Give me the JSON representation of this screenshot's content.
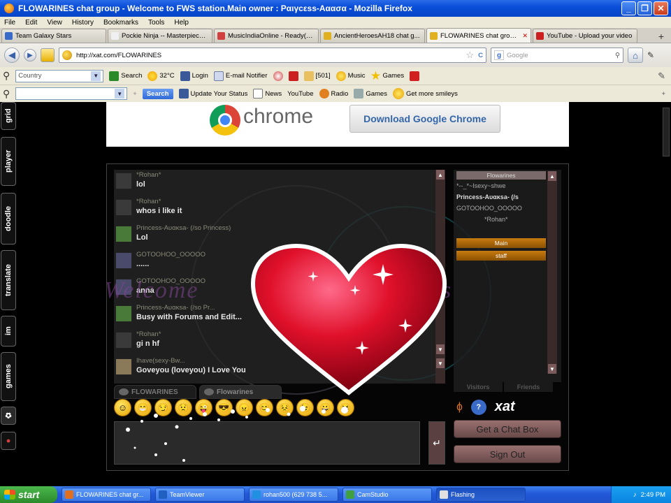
{
  "window": {
    "title": "FLOWARINES chat group - Welcome to FWS station.Main owner : Ραιγcεss-Ααασα - Mozilla Firefox",
    "controls": [
      "_",
      "❐",
      "✕"
    ]
  },
  "menu": [
    "File",
    "Edit",
    "View",
    "History",
    "Bookmarks",
    "Tools",
    "Help"
  ],
  "tabs": [
    {
      "label": "Team Galaxy Stars",
      "color": "#3a6ac8"
    },
    {
      "label": "Pockie Ninja -- Masterpiece ...",
      "color": "#f0f0f0"
    },
    {
      "label": "MusicIndiaOnline - Ready(2...",
      "color": "#d04040"
    },
    {
      "label": "AncientHeroesAH18 chat g...",
      "color": "#e0b020"
    },
    {
      "label": "FLOWARINES chat group - ...",
      "color": "#e0b020",
      "active": true
    },
    {
      "label": "YouTube - Upload your video",
      "color": "#cc2020"
    }
  ],
  "newtab_label": "+",
  "nav": {
    "back": "◀",
    "forward": "▶",
    "url": "http://xat.com/FLOWARINES",
    "search_placeholder": "Google",
    "star": "☆",
    "reload": "C"
  },
  "toolbar1": {
    "country_placeholder": "Country",
    "search_label": "Search",
    "temperature": "32°C",
    "login": "Login",
    "email_notifier": "E-mail Notifier",
    "count": "[501]",
    "music": "Music",
    "games": "Games"
  },
  "toolbar2": {
    "search_button": "Search",
    "update_status": "Update Your Status",
    "news": "News",
    "youtube": "YouTube",
    "radio": "Radio",
    "games": "Games",
    "smileys": "Get more smileys"
  },
  "sidebar": [
    "grid",
    "player",
    "doodle",
    "translate",
    "im",
    "games",
    ""
  ],
  "ad": {
    "brand": "chrome",
    "button": "Download Google Chrome"
  },
  "chat": {
    "welcome_text": "Welcome",
    "welcome_tail": "ines",
    "messages": [
      {
        "name": "*Rohan*",
        "text": "lol",
        "avatar": "#3a3a3a"
      },
      {
        "name": "*Rohan*",
        "text": "whos i like it",
        "avatar": "#3a3a3a"
      },
      {
        "name": "Princess-Aυακsa- (/so Princess)",
        "text": "Lol",
        "avatar": "#4a7a3a"
      },
      {
        "name": "GOTOOHOO_OOOOO",
        "text": "......",
        "avatar": "#4a4a6a"
      },
      {
        "name": "GOTOOHOO_OOOOO",
        "text": "anna",
        "avatar": "#4a4a6a"
      },
      {
        "name": "Princess-Aυακsa- (/so Pr...",
        "text": "Busy with Forums and Edit...",
        "avatar": "#4a7a3a"
      },
      {
        "name": "*Rohan*",
        "text": "gi n hf",
        "avatar": "#3a3a3a"
      },
      {
        "name": "Ihave(sexy-Bw...",
        "text": "Goveyou (loveyou) I Love You",
        "avatar": "#8a7a5a"
      }
    ],
    "tabs": [
      "FLOWARINES",
      "Flowarines"
    ],
    "userlist": {
      "header": "Flowarines",
      "users": [
        "*--_*~Isexy~shwe",
        "Princess-Aυακsa- (/s",
        "GOTOOHOO_OOOOO",
        "*Rohan*"
      ],
      "bars": [
        "Main",
        "staff"
      ],
      "tabs": [
        "Visitors",
        "Friends"
      ]
    },
    "smileys": [
      "☺",
      "😁",
      "😏",
      "😟",
      "😜",
      "😎",
      "😠",
      "😊",
      "😣",
      "😉",
      "😀",
      "😆"
    ],
    "extra_icons": [
      "ɸ",
      "?"
    ],
    "xat_logo": "xat",
    "send": "↵",
    "get_chat_box": "Get a Chat Box",
    "sign_out": "Sign Out"
  },
  "taskbar": {
    "start": "start",
    "items": [
      {
        "label": "FLOWARINES chat gr...",
        "color": "#e07020"
      },
      {
        "label": "TeamViewer",
        "color": "#2060c0"
      },
      {
        "label": "rohan500 (629 738 5...",
        "color": "#2090e0"
      },
      {
        "label": "CamStudio",
        "color": "#40a040"
      },
      {
        "label": "Flashing",
        "color": "#e0e0e0",
        "active": true
      }
    ],
    "clock": "2:49 PM"
  }
}
